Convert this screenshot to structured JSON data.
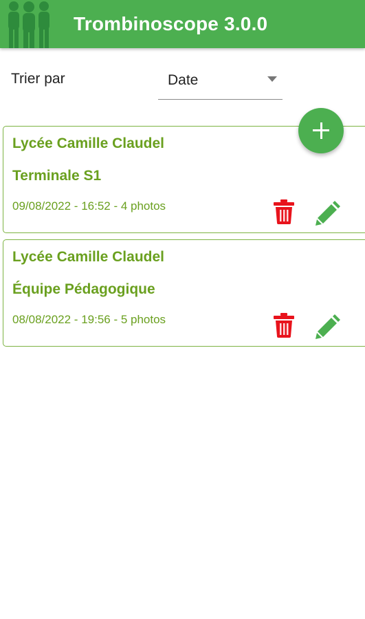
{
  "app": {
    "title": "Trombinoscope 3.0.0",
    "accent_color": "#4caf50",
    "logo_icon": "people-group-icon"
  },
  "sort": {
    "label": "Trier par",
    "selected": "Date"
  },
  "fab": {
    "icon": "plus-icon"
  },
  "cards": [
    {
      "school": "Lycée Camille Claudel",
      "group": "Terminale S1",
      "meta": "09/08/2022 - 16:52 - 4 photos"
    },
    {
      "school": "Lycée Camille Claudel",
      "group": "Équipe Pédagogique",
      "meta": "08/08/2022 - 19:56 - 5 photos"
    }
  ],
  "colors": {
    "text_green": "#6aa01f",
    "delete_red": "#e8131c",
    "edit_green": "#4caf50"
  }
}
